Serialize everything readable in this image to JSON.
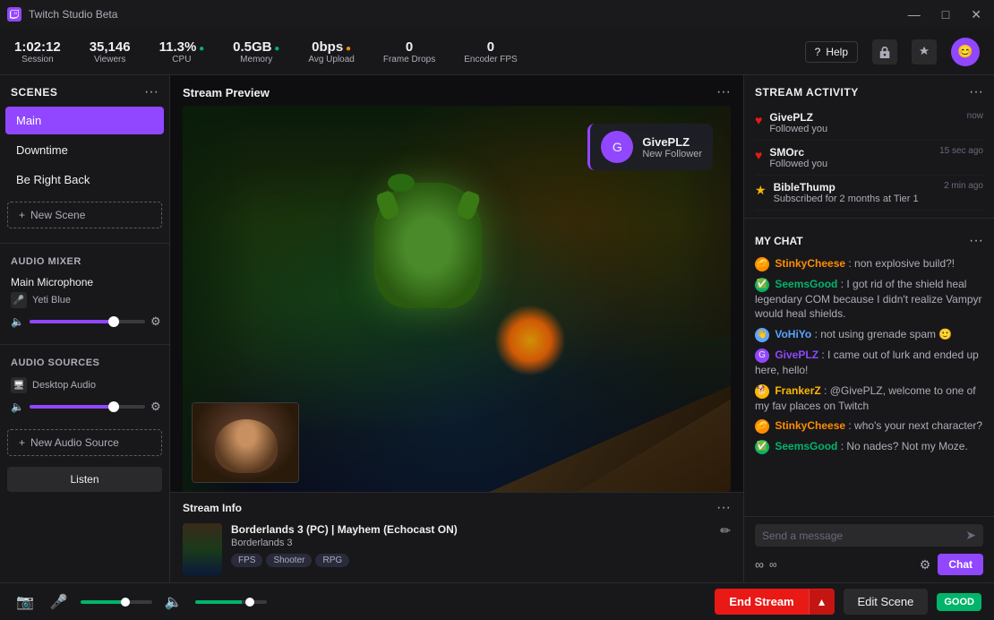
{
  "titlebar": {
    "app_name": "Twitch Studio Beta",
    "controls": {
      "minimize": "—",
      "maximize": "□",
      "close": "✕"
    }
  },
  "statsbar": {
    "session_time": "1:02:12",
    "session_label": "Session",
    "viewers": "35,146",
    "viewers_label": "Viewers",
    "cpu": "11.3%",
    "cpu_label": "CPU",
    "memory": "0.5GB",
    "memory_label": "Memory",
    "upload": "0bps",
    "upload_label": "Avg Upload",
    "frame_drops": "0",
    "frame_drops_label": "Frame Drops",
    "encoder_fps": "0",
    "encoder_fps_label": "Encoder FPS",
    "help_label": "Help"
  },
  "scenes": {
    "panel_title": "Scenes",
    "items": [
      {
        "name": "Main",
        "active": true
      },
      {
        "name": "Downtime",
        "active": false
      },
      {
        "name": "Be Right Back",
        "active": false
      }
    ],
    "new_scene_label": "New Scene"
  },
  "audio_mixer": {
    "title": "Audio Mixer",
    "main_mic_label": "Main Microphone",
    "main_mic_device": "Yeti Blue",
    "audio_sources_label": "Audio Sources",
    "desktop_audio_label": "Desktop Audio",
    "new_audio_label": "New Audio Source",
    "listen_label": "Listen"
  },
  "stream_preview": {
    "title": "Stream Preview",
    "follower_notification": {
      "name": "GivePLZ",
      "subtitle": "New Follower"
    }
  },
  "stream_info": {
    "title": "Stream Info",
    "game_title": "Borderlands 3 (PC) | Mayhem (Echocast ON)",
    "game_name": "Borderlands 3",
    "tags": [
      "FPS",
      "Shooter",
      "RPG"
    ],
    "edit_icon": "✏"
  },
  "bottom_bar": {
    "end_stream_label": "End Stream",
    "edit_scene_label": "Edit Scene",
    "good_label": "GOOD"
  },
  "stream_activity": {
    "title": "Stream Activity",
    "more_icon": "•••",
    "items": [
      {
        "type": "heart",
        "name": "GivePLZ",
        "action": "Followed you",
        "time": "now"
      },
      {
        "type": "heart",
        "name": "SMOrc",
        "action": "Followed you",
        "time": "15 sec ago"
      },
      {
        "type": "star",
        "name": "BibleThump",
        "action": "Subscribed for 2 months at Tier 1",
        "time": "2 min ago"
      }
    ]
  },
  "chat": {
    "title": "My Chat",
    "messages": [
      {
        "user": "StinkyCheese",
        "color": "orange",
        "text": "non explosive build?!"
      },
      {
        "user": "SeemsGood",
        "color": "green",
        "text": "I got rid of the shield heal legendary COM because I didn't realize Vampyr would heal shields."
      },
      {
        "user": "VoHiYo",
        "color": "blue",
        "text": "not using grenade spam 🙂"
      },
      {
        "user": "GivePLZ",
        "color": "purple",
        "text": "I came out of lurk and ended up here, hello!"
      },
      {
        "user": "FrankerZ",
        "color": "yellow",
        "text": "@GivePLZ, welcome to one of my fav places on Twitch"
      },
      {
        "user": "StinkyCheese",
        "color": "orange",
        "text": "who's your next character?"
      },
      {
        "user": "SeemsGood",
        "color": "green",
        "text": "No nades? Not my Moze."
      }
    ],
    "input_placeholder": "Send a message",
    "send_label": "Chat",
    "infinity": "∞"
  }
}
